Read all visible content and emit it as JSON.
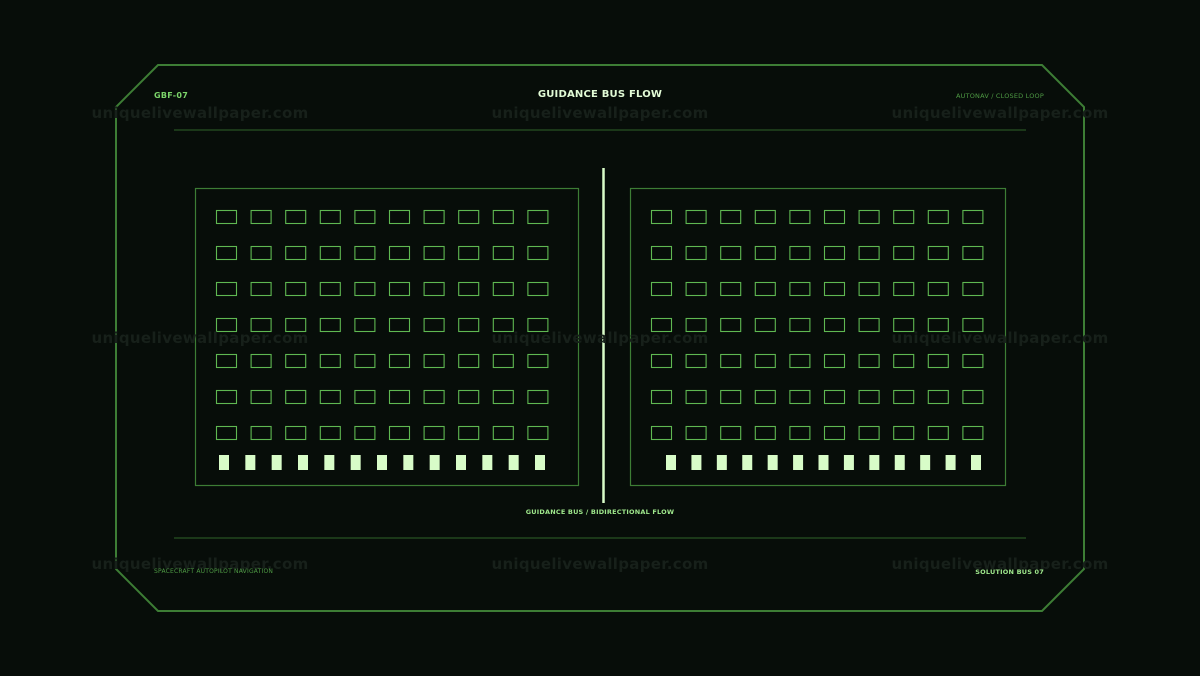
{
  "header": {
    "id_code": "GBF-07",
    "title": "GUIDANCE BUS FLOW",
    "mode": "AUTONAV / CLOSED LOOP"
  },
  "bus": {
    "caption": "GUIDANCE BUS / BIDIRECTIONAL FLOW"
  },
  "footer": {
    "left": "SPACECRAFT AUTOPILOT NAVIGATION",
    "right": "SOLUTION BUS 07"
  },
  "panels": [
    {
      "name": "left-panel",
      "rows": 7,
      "cols": 10,
      "indicators": 13
    },
    {
      "name": "right-panel",
      "rows": 7,
      "cols": 10,
      "indicators": 13
    }
  ],
  "watermark": "uniquelivewallpaper.com",
  "colors": {
    "background": "#070d09",
    "frame": "#3d7d35",
    "cell": "#5fb852",
    "indicator": "#d8fcc8",
    "title": "#e2fbd6",
    "accent": "#7cd46a"
  }
}
